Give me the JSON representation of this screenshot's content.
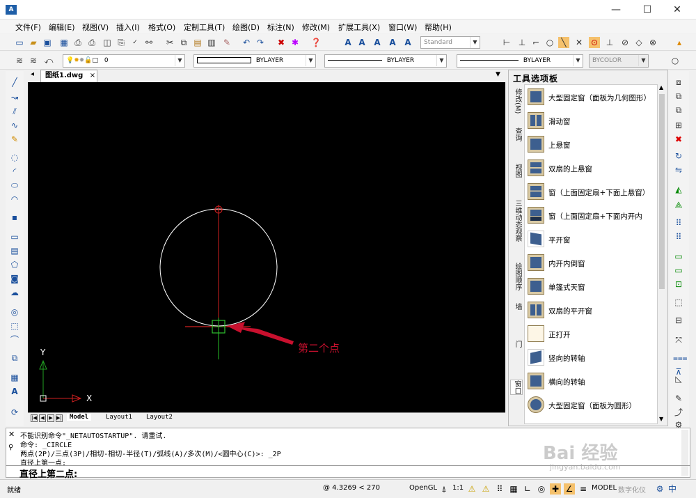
{
  "window": {
    "title": "",
    "logo": "A",
    "minimize": "—",
    "maximize": "☐",
    "close": "✕"
  },
  "menu": [
    "文件(F)",
    "编辑(E)",
    "视图(V)",
    "插入(I)",
    "格式(O)",
    "定制工具(T)",
    "绘图(D)",
    "标注(N)",
    "修改(M)",
    "扩展工具(X)",
    "窗口(W)",
    "帮助(H)"
  ],
  "toolbar2": {
    "text_style": "Standard"
  },
  "toolbar3": {
    "layer": "0",
    "color": "BYLAYER",
    "linetype": "BYLAYER",
    "lineweight": "BYLAYER",
    "plotstyle": "BYCOLOR"
  },
  "document": {
    "tab": "图纸1.dwg",
    "close": "×"
  },
  "canvas": {
    "annotation": "第二个点",
    "axis_x": "X",
    "axis_y": "Y",
    "colors": {
      "background": "#000000",
      "circle": "#ffffff",
      "crosshair_v": "#22a022",
      "crosshair_h": "#d02020",
      "arrow": "#c8102e"
    }
  },
  "layouts": {
    "nav": [
      "|◀",
      "◀",
      "▶",
      "▶|"
    ],
    "tabs": [
      "Model",
      "Layout1",
      "Layout2"
    ]
  },
  "palette": {
    "title": "工具选项板",
    "side_tabs": [
      "修改(M)",
      "查询",
      "视图",
      "三维动态观察",
      "绘图顺序",
      "墙",
      "门",
      "窗口"
    ],
    "items": [
      "大型固定窗（面板为几何图形）",
      "滑动窗",
      "上悬窗",
      "双扇的上悬窗",
      "窗（上面固定扇+下面上悬窗）",
      "窗（上面固定扇+下面内开内",
      "平开窗",
      "内开内倒窗",
      "单篷式天窗",
      "双扇的平开窗",
      "正打开",
      "竖向的转轴",
      "横向的转轴",
      "大型固定窗（面板为圆形）"
    ]
  },
  "command": {
    "lines": [
      "不能识别命令\"_NETAUTOSTARTUP\". 请重试.",
      "命令: _CIRCLE",
      "两点(2P)/三点(3P)/相切-相切-半径(T)/弧线(A)/多次(M)/<圆中心(C)>: _2P",
      "直径上第一点:"
    ],
    "prompt": "直径上第二点:"
  },
  "status": {
    "ready": "就绪",
    "coords": "@ 4.3269 < 270",
    "opengl": "OpenGL",
    "scale": "1:1",
    "model": "MODEL",
    "digitize": "数字化仪"
  },
  "watermark": {
    "main": "Bai 经验",
    "sub": "jingyan.baidu.com"
  }
}
